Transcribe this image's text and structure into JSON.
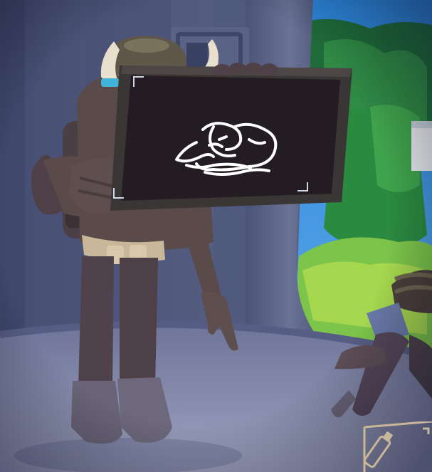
{
  "scene": {
    "description_free": true,
    "colors": {
      "wall_left": "#5b6585",
      "wall_right": "#3c4468",
      "floor": "#8f95b4",
      "window_sky": "#2f7fd0",
      "foliage_dark": "#1f6b3a",
      "foliage_light": "#6cc64a",
      "grass": "#a6d84f",
      "character_body": "#5a4a4a",
      "character_hat": "#6e6650",
      "horn": "#e8dfcc",
      "horn_ring": "#3fb4d8",
      "belt": "#c9b79a",
      "frame": "#3a3636",
      "canvas": "#231c22",
      "doodle": "#ffffff",
      "bracket": "#cfd6e8"
    }
  },
  "drawing_board": {
    "icon": "sketch-doodle-icon"
  },
  "hud": {
    "slot_icon": "tool-slot-icon"
  }
}
